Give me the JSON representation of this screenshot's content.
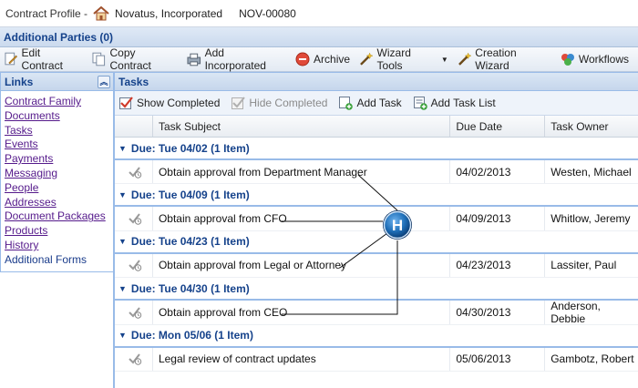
{
  "title": {
    "label": "Contract Profile -",
    "company": "Novatus, Incorporated",
    "contract_id": "NOV-00080",
    "icon": "house-icon"
  },
  "parties_bar": "Additional Parties (0)",
  "toolbar": [
    {
      "label": "Edit Contract",
      "icon": "edit-document-icon"
    },
    {
      "label": "Copy Contract",
      "icon": "copy-document-icon"
    },
    {
      "label": "Add Incorporated",
      "icon": "printer-add-icon"
    },
    {
      "label": "Archive",
      "icon": "archive-stop-icon"
    },
    {
      "label": "Wizard Tools",
      "icon": "wand-icon"
    },
    {
      "label": "Creation Wizard",
      "icon": "wand-icon"
    },
    {
      "label": "Workflows",
      "icon": "workflow-icon"
    }
  ],
  "sidebar": {
    "title": "Links",
    "links": [
      "Contract Family",
      "Documents",
      "Tasks",
      "Events",
      "Payments",
      "Messaging",
      "People",
      "Addresses",
      "Document Packages",
      "Products",
      "History",
      "Additional Forms"
    ]
  },
  "tasks": {
    "title": "Tasks",
    "toolbar": {
      "show_completed": "Show Completed",
      "hide_completed": "Hide Completed",
      "add_task": "Add Task",
      "add_task_list": "Add Task List"
    },
    "columns": {
      "subject": "Task Subject",
      "due": "Due Date",
      "owner": "Task Owner"
    },
    "groups": [
      {
        "label": "Due: Tue 04/02 (1 Item)",
        "task": {
          "subject": "Obtain approval from Department Manager",
          "due": "04/02/2013",
          "owner": "Westen, Michael"
        }
      },
      {
        "label": "Due: Tue 04/09 (1 Item)",
        "task": {
          "subject": "Obtain approval from CFO",
          "due": "04/09/2013",
          "owner": "Whitlow, Jeremy"
        }
      },
      {
        "label": "Due: Tue 04/23 (1 Item)",
        "task": {
          "subject": "Obtain approval from Legal or Attorney",
          "due": "04/23/2013",
          "owner": "Lassiter, Paul"
        }
      },
      {
        "label": "Due: Tue 04/30 (1 Item)",
        "task": {
          "subject": "Obtain approval from CEO",
          "due": "04/30/2013",
          "owner": "Anderson, Debbie"
        }
      },
      {
        "label": "Due: Mon 05/06 (1 Item)",
        "task": {
          "subject": "Legal review of contract updates",
          "due": "05/06/2013",
          "owner": "Gambotz, Robert"
        }
      }
    ]
  },
  "callout": {
    "letter": "H",
    "color": "#1f6fb8"
  }
}
